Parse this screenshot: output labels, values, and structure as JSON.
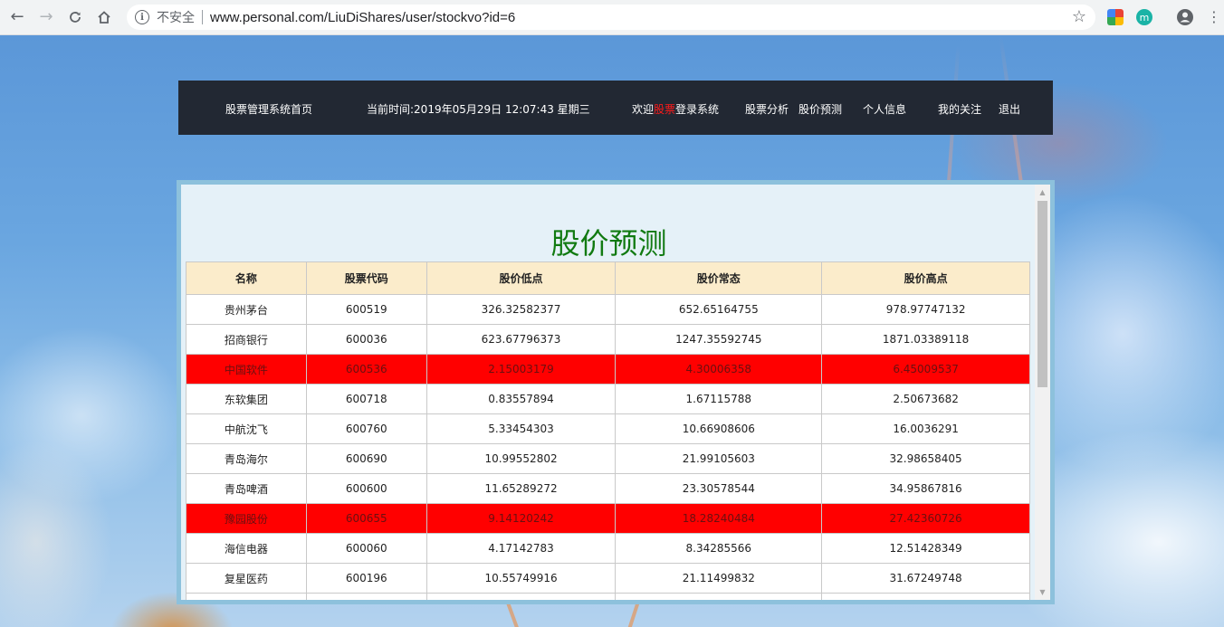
{
  "browser": {
    "security_label": "不安全",
    "url": "www.personal.com/LiuDiShares/user/stockvo?id=6",
    "icons": {
      "back": "back-arrow-icon",
      "forward": "forward-arrow-icon",
      "reload": "reload-icon",
      "home": "home-icon",
      "info": "info-icon",
      "star": "star-icon",
      "profile": "profile-icon",
      "menu": "kebab-menu-icon"
    },
    "info_glyph": "i",
    "ext_m_label": "m"
  },
  "header": {
    "home_link": "股票管理系统首页",
    "time_prefix": "当前时间:",
    "time_value": "2019年05月29日 12:07:43 星期三",
    "welcome_prefix": "欢迎",
    "welcome_user": "股票",
    "welcome_suffix": "登录系统",
    "nav": [
      "股票分析",
      "股价预测",
      "个人信息",
      "我的关注",
      "退出"
    ]
  },
  "page": {
    "title": "股价预测",
    "columns": [
      "名称",
      "股票代码",
      "股价低点",
      "股价常态",
      "股价高点"
    ],
    "rows": [
      {
        "name": "贵州茅台",
        "code": "600519",
        "low": "326.32582377",
        "normal": "652.65164755",
        "high": "978.97747132",
        "highlight": false
      },
      {
        "name": "招商银行",
        "code": "600036",
        "low": "623.67796373",
        "normal": "1247.35592745",
        "high": "1871.03389118",
        "highlight": false
      },
      {
        "name": "中国软件",
        "code": "600536",
        "low": "2.15003179",
        "normal": "4.30006358",
        "high": "6.45009537",
        "highlight": true
      },
      {
        "name": "东软集团",
        "code": "600718",
        "low": "0.83557894",
        "normal": "1.67115788",
        "high": "2.50673682",
        "highlight": false
      },
      {
        "name": "中航沈飞",
        "code": "600760",
        "low": "5.33454303",
        "normal": "10.66908606",
        "high": "16.0036291",
        "highlight": false
      },
      {
        "name": "青岛海尔",
        "code": "600690",
        "low": "10.99552802",
        "normal": "21.99105603",
        "high": "32.98658405",
        "highlight": false
      },
      {
        "name": "青岛啤酒",
        "code": "600600",
        "low": "11.65289272",
        "normal": "23.30578544",
        "high": "34.95867816",
        "highlight": false
      },
      {
        "name": "豫园股份",
        "code": "600655",
        "low": "9.14120242",
        "normal": "18.28240484",
        "high": "27.42360726",
        "highlight": true
      },
      {
        "name": "海信电器",
        "code": "600060",
        "low": "4.17142783",
        "normal": "8.34285566",
        "high": "12.51428349",
        "highlight": false
      },
      {
        "name": "复星医药",
        "code": "600196",
        "low": "10.55749916",
        "normal": "21.11499832",
        "high": "31.67249748",
        "highlight": false
      },
      {
        "name": "",
        "code": "",
        "low": "",
        "normal": "",
        "high": "",
        "highlight": false
      }
    ]
  },
  "colors": {
    "header_bg": "#222833",
    "title_green": "#117a11",
    "highlight_red": "#ff0000",
    "welcome_user_red": "#ff1a1a",
    "table_header_bg": "#fbeccb"
  }
}
